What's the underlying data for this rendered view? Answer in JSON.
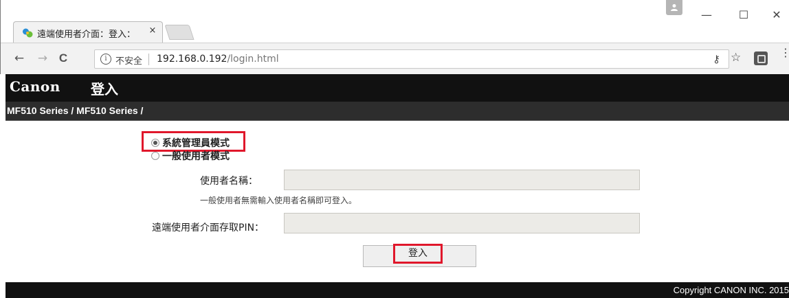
{
  "browser": {
    "tab": {
      "title": "遠端使用者介面：登入：",
      "close_glyph": "×",
      "favicon": "canon-remote-ui-icon"
    },
    "window_controls": {
      "minimize": "—",
      "maximize": "☐",
      "close": "✕"
    },
    "toolbar": {
      "back": "←",
      "forward": "→",
      "reload": "C",
      "security_label": "不安全",
      "url_host": "192.168.0.192",
      "url_path": "/login.html",
      "key_icon_glyph": "⚷",
      "bookmark_glyph": "☆",
      "menu_glyph": "⋮"
    }
  },
  "header": {
    "logo": "Canon",
    "title": "登入"
  },
  "breadcrumb": "MF510 Series / MF510 Series /",
  "login_form": {
    "modes": [
      {
        "label": "系統管理員模式",
        "checked": true
      },
      {
        "label": "一般使用者模式",
        "checked": false
      }
    ],
    "username_label": "使用者名稱：",
    "username_value": "",
    "hint": "一般使用者無需輸入使用者名稱即可登入。",
    "pin_label": "遠端使用者介面存取PIN：",
    "pin_value": "",
    "submit_label": "登入"
  },
  "footer": {
    "copyright": "Copyright CANON INC. 2015"
  },
  "colors": {
    "header_bg": "#111111",
    "subheader_bg": "#2d2d2d",
    "highlight": "#e0172b",
    "input_bg": "#ecebe7"
  }
}
